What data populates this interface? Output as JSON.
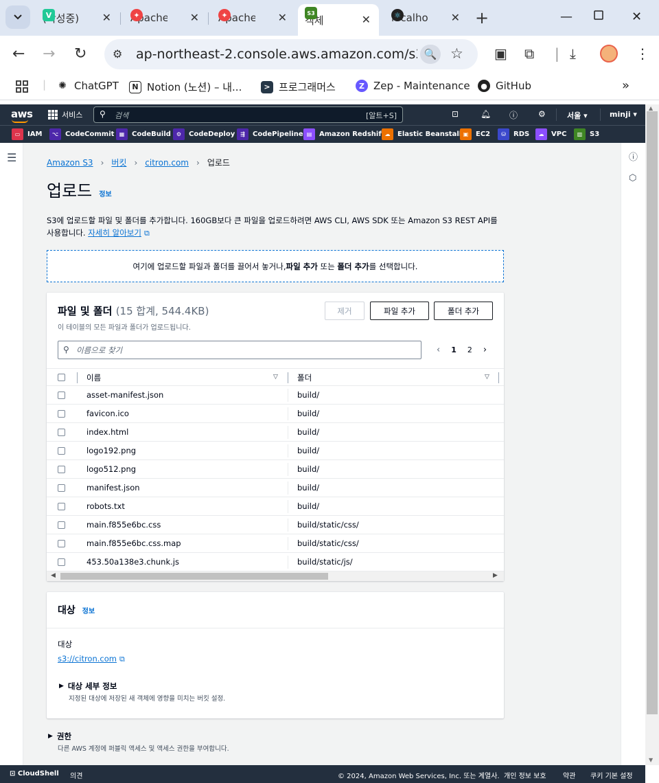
{
  "browser": {
    "tabs": [
      {
        "title": "(작성중)",
        "favicon_color": "#20c997",
        "favicon_glyph": "V"
      },
      {
        "title": "Apache",
        "favicon_color": "#ef4444",
        "favicon_glyph": "✦"
      },
      {
        "title": "Apache",
        "favicon_color": "#ef4444",
        "favicon_glyph": "✦"
      },
      {
        "title": "객체",
        "favicon_color": "#3f8624",
        "favicon_glyph": "S3"
      },
      {
        "title": "localhost",
        "favicon_color": "#222",
        "favicon_glyph": "⚛"
      }
    ],
    "url": "ap-northeast-2.console.aws.amazon.com/s3/upload/citron.com",
    "bookmarks": [
      {
        "label": "ChatGPT"
      },
      {
        "label": "Notion (노션) – 내..."
      },
      {
        "label": "프로그래머스"
      },
      {
        "label": "Zep - Maintenance"
      },
      {
        "label": "GitHub"
      }
    ]
  },
  "aws": {
    "logo": "aws",
    "services_label": "서비스",
    "search_placeholder": "검색",
    "search_shortcut": "[알트+S]",
    "region": "서울 ▾",
    "user": "minji ▾",
    "favorites": [
      "IAM",
      "CodeCommit",
      "CodeBuild",
      "CodeDeploy",
      "CodePipeline",
      "Amazon Redshift",
      "Elastic Beanstalk",
      "EC2",
      "RDS",
      "VPC",
      "S3"
    ]
  },
  "breadcrumb": {
    "items": [
      "Amazon S3",
      "버킷",
      "citron.com"
    ],
    "current": "업로드"
  },
  "page": {
    "title": "업로드",
    "info": "정보",
    "desc_line1": "S3에 업로드할 파일 및 폴더를 추가합니다. 160GB보다 큰 파일을 업로드하려면 AWS CLI, AWS SDK 또는 Amazon S3 REST API를",
    "desc_line2": "사용합니다.",
    "learn_more": "자세히 알아보기",
    "dropzone_pre": "여기에 업로드할 파일과 폴더를 끌어서 놓거나, ",
    "dropzone_b1": "파일 추가",
    "dropzone_mid": " 또는 ",
    "dropzone_b2": "폴더 추가",
    "dropzone_post": "를 선택합니다."
  },
  "files": {
    "title": "파일 및 폴더",
    "count": "(15 합계, 544.4KB)",
    "subtitle": "이 테이블의 모든 파일과 폴더가 업로드됩니다.",
    "btn_remove": "제거",
    "btn_add_files": "파일 추가",
    "btn_add_folder": "폴더 추가",
    "search_placeholder": "이름으로 찾기",
    "pages": [
      "1",
      "2"
    ],
    "col_name": "이름",
    "col_folder": "폴더",
    "rows": [
      {
        "name": "asset-manifest.json",
        "folder": "build/"
      },
      {
        "name": "favicon.ico",
        "folder": "build/"
      },
      {
        "name": "index.html",
        "folder": "build/"
      },
      {
        "name": "logo192.png",
        "folder": "build/"
      },
      {
        "name": "logo512.png",
        "folder": "build/"
      },
      {
        "name": "manifest.json",
        "folder": "build/"
      },
      {
        "name": "robots.txt",
        "folder": "build/"
      },
      {
        "name": "main.f855e6bc.css",
        "folder": "build/static/css/"
      },
      {
        "name": "main.f855e6bc.css.map",
        "folder": "build/static/css/"
      },
      {
        "name": "453.50a138e3.chunk.js",
        "folder": "build/static/js/"
      }
    ]
  },
  "destination": {
    "title": "대상",
    "info": "정보",
    "label": "대상",
    "link": "s3://citron.com",
    "details_title": "대상 세부 정보",
    "details_sub": "지정된 대상에 저장된 새 객체에 영향을 미치는 버킷 설정."
  },
  "permissions": {
    "title": "권한",
    "sub": "다른 AWS 계정에 퍼블릭 액세스 및 액세스 권한을 부여합니다."
  },
  "footer": {
    "cloudshell": "CloudShell",
    "feedback": "의견",
    "copyright": "© 2024, Amazon Web Services, Inc. 또는 계열사.",
    "privacy": "개인 정보 보호",
    "terms": "약관",
    "cookies": "쿠키 기본 설정"
  }
}
